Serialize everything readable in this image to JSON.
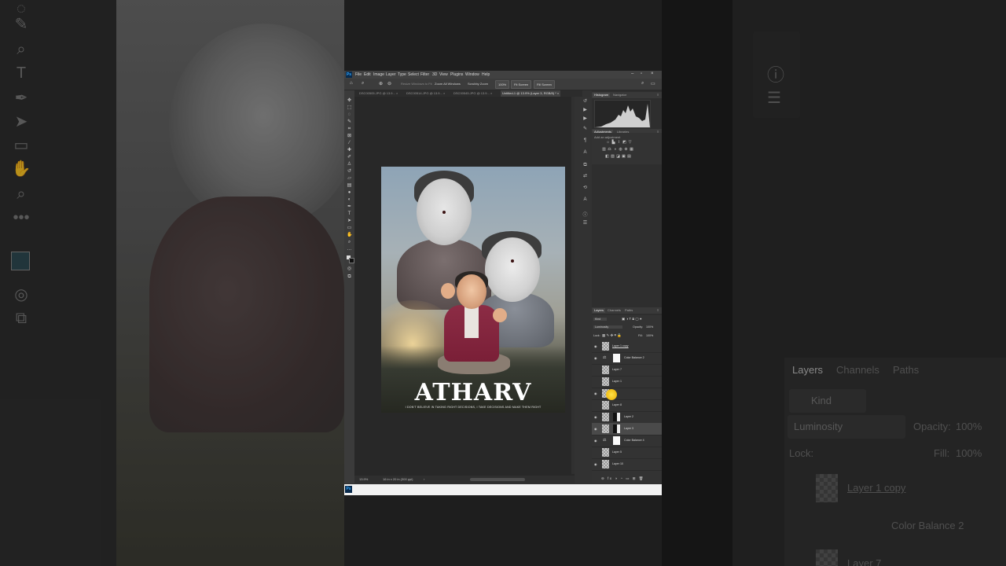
{
  "app": {
    "logo": "Ps",
    "menu": [
      "File",
      "Edit",
      "Image",
      "Layer",
      "Type",
      "Select",
      "Filter",
      "3D",
      "View",
      "Plugins",
      "Window",
      "Help"
    ]
  },
  "options_bar": {
    "resize_windows": "Resize Windows to Fit",
    "zoom_all": "Zoom All Windows",
    "scrubby_zoom": "Scrubby Zoom",
    "zoom_value": "100%",
    "fit_screen": "Fit Screen",
    "fill_screen": "Fill Screen"
  },
  "tabs": [
    {
      "label": "DSC00505.JPG @ 13.9... ×",
      "active": false
    },
    {
      "label": "DSC00514.JPG @ 13.9... ×",
      "active": false
    },
    {
      "label": "DSC00545.JPG @ 13.9... ×",
      "active": false
    },
    {
      "label": "Untitled-1 @ 13.9% (Layer 3, RGB/8) * ×",
      "active": true
    }
  ],
  "artwork": {
    "title": "ATHARV",
    "subtitle": "I DON'T BELIEVE IN TAKING RIGHT DECISIONS, I TAKE DECISIONS AND MAKE THEM RIGHT"
  },
  "status_bar": {
    "zoom": "13.9%",
    "doc_size": "16 in x 20 in (300 ppi)"
  },
  "panels": {
    "top_tabs": [
      "Histogram",
      "Navigator"
    ],
    "adj_tabs": [
      "Adjustments",
      "Libraries"
    ],
    "adj_hint": "Add an adjustment",
    "layer_tabs": [
      "Layers",
      "Channels",
      "Paths"
    ],
    "kind": "Kind",
    "blend_mode": "Luminosity",
    "opacity_label": "Opacity:",
    "opacity": "100%",
    "lock_label": "Lock:",
    "fill_label": "Fill:",
    "fill": "100%"
  },
  "layers": [
    {
      "name": "Layer 1 copy",
      "type": "pixel"
    },
    {
      "name": "Color Balance 2",
      "type": "adjustment"
    },
    {
      "name": "Layer 7",
      "type": "pixel"
    },
    {
      "name": "Layer 1",
      "type": "pixel"
    },
    {
      "name": "",
      "type": "pixel"
    },
    {
      "name": "Layer 8",
      "type": "pixel"
    },
    {
      "name": "Layer 2",
      "type": "masked"
    },
    {
      "name": "Layer 3",
      "type": "masked",
      "selected": true
    },
    {
      "name": "Color Balance 4",
      "type": "adjustment"
    },
    {
      "name": "Layer 5",
      "type": "pixel"
    },
    {
      "name": "Layer 10",
      "type": "pixel"
    }
  ],
  "background_panel": {
    "tabs": [
      "Layers",
      "Channels",
      "Paths"
    ],
    "kind": "Kind",
    "blend_mode": "Luminosity",
    "opacity_label": "Opacity:",
    "opacity": "100%",
    "lock_label": "Lock:",
    "fill_label": "Fill:",
    "fill": "100%",
    "layers": [
      "Layer 1 copy",
      "Color Balance 2",
      "Layer 7"
    ]
  },
  "colors": {
    "accent_cursor": "#f3c21b",
    "ps_blue": "#31a8ff",
    "panel_bg": "#323232"
  }
}
